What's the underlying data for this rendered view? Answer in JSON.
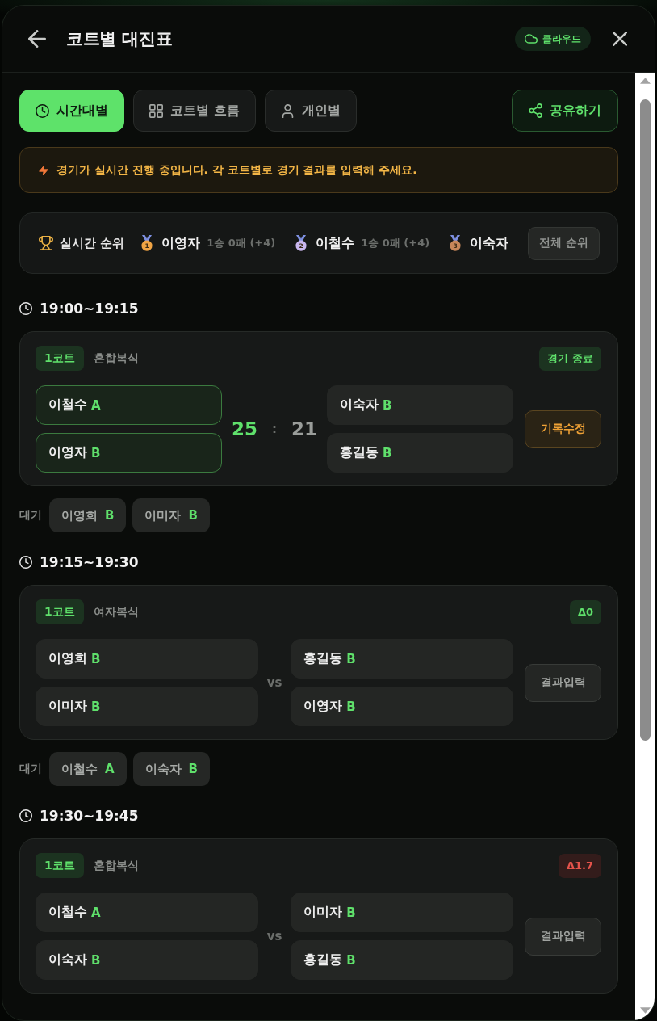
{
  "header": {
    "title": "코트별 대진표",
    "badge": "클라우드"
  },
  "tabs": [
    {
      "label": "시간대별",
      "selected": true
    },
    {
      "label": "코트별 흐름",
      "selected": false
    },
    {
      "label": "개인별",
      "selected": false
    }
  ],
  "share_button": "공유하기",
  "alert": "경기가 실시간 진행 중입니다. 각 코트별로 경기 결과를 입력해 주세요.",
  "ranking": {
    "title": "실시간 순위",
    "entries": [
      {
        "rank": "1",
        "color": "#f0a444",
        "name": "이영자",
        "record": "1승 0패 (+4)"
      },
      {
        "rank": "2",
        "color": "#c8b6ee",
        "name": "이철수",
        "record": "1승 0패 (+4)"
      },
      {
        "rank": "3",
        "color": "#c7875a",
        "name": "이숙자"
      }
    ],
    "button": "전체 순위"
  },
  "slots": [
    {
      "time": "19:00~19:15",
      "matches": [
        {
          "court": "1코트",
          "type": "혼합복식",
          "status": {
            "text": "경기 종료",
            "kind": "good"
          },
          "teams": [
            {
              "winner": true,
              "score": "25",
              "players": [
                {
                  "name": "이철수",
                  "grade": "A"
                },
                {
                  "name": "이영자",
                  "grade": "B"
                }
              ]
            },
            {
              "winner": false,
              "score": "21",
              "players": [
                {
                  "name": "이숙자",
                  "grade": "B"
                },
                {
                  "name": "홍길동",
                  "grade": "B"
                }
              ]
            }
          ],
          "separator": ":",
          "action": {
            "kind": "edit",
            "label": "기록수정"
          }
        }
      ],
      "waiting": {
        "label": "대기",
        "players": [
          {
            "name": "이영희",
            "grade": "B"
          },
          {
            "name": "이미자",
            "grade": "B"
          }
        ]
      }
    },
    {
      "time": "19:15~19:30",
      "matches": [
        {
          "court": "1코트",
          "type": "여자복식",
          "status": {
            "text": "Δ0",
            "kind": "good"
          },
          "teams": [
            {
              "winner": false,
              "players": [
                {
                  "name": "이영희",
                  "grade": "B"
                },
                {
                  "name": "이미자",
                  "grade": "B"
                }
              ]
            },
            {
              "winner": false,
              "players": [
                {
                  "name": "홍길동",
                  "grade": "B"
                },
                {
                  "name": "이영자",
                  "grade": "B"
                }
              ]
            }
          ],
          "separator": "vs",
          "action": {
            "kind": "enter",
            "label": "결과입력"
          }
        }
      ],
      "waiting": {
        "label": "대기",
        "players": [
          {
            "name": "이철수",
            "grade": "A"
          },
          {
            "name": "이숙자",
            "grade": "B"
          }
        ]
      }
    },
    {
      "time": "19:30~19:45",
      "matches": [
        {
          "court": "1코트",
          "type": "혼합복식",
          "status": {
            "text": "Δ1.7",
            "kind": "bad"
          },
          "teams": [
            {
              "winner": false,
              "players": [
                {
                  "name": "이철수",
                  "grade": "A"
                },
                {
                  "name": "이숙자",
                  "grade": "B"
                }
              ]
            },
            {
              "winner": false,
              "players": [
                {
                  "name": "이미자",
                  "grade": "B"
                },
                {
                  "name": "홍길동",
                  "grade": "B"
                }
              ]
            }
          ],
          "separator": "vs",
          "action": {
            "kind": "enter",
            "label": "결과입력"
          }
        }
      ]
    }
  ]
}
